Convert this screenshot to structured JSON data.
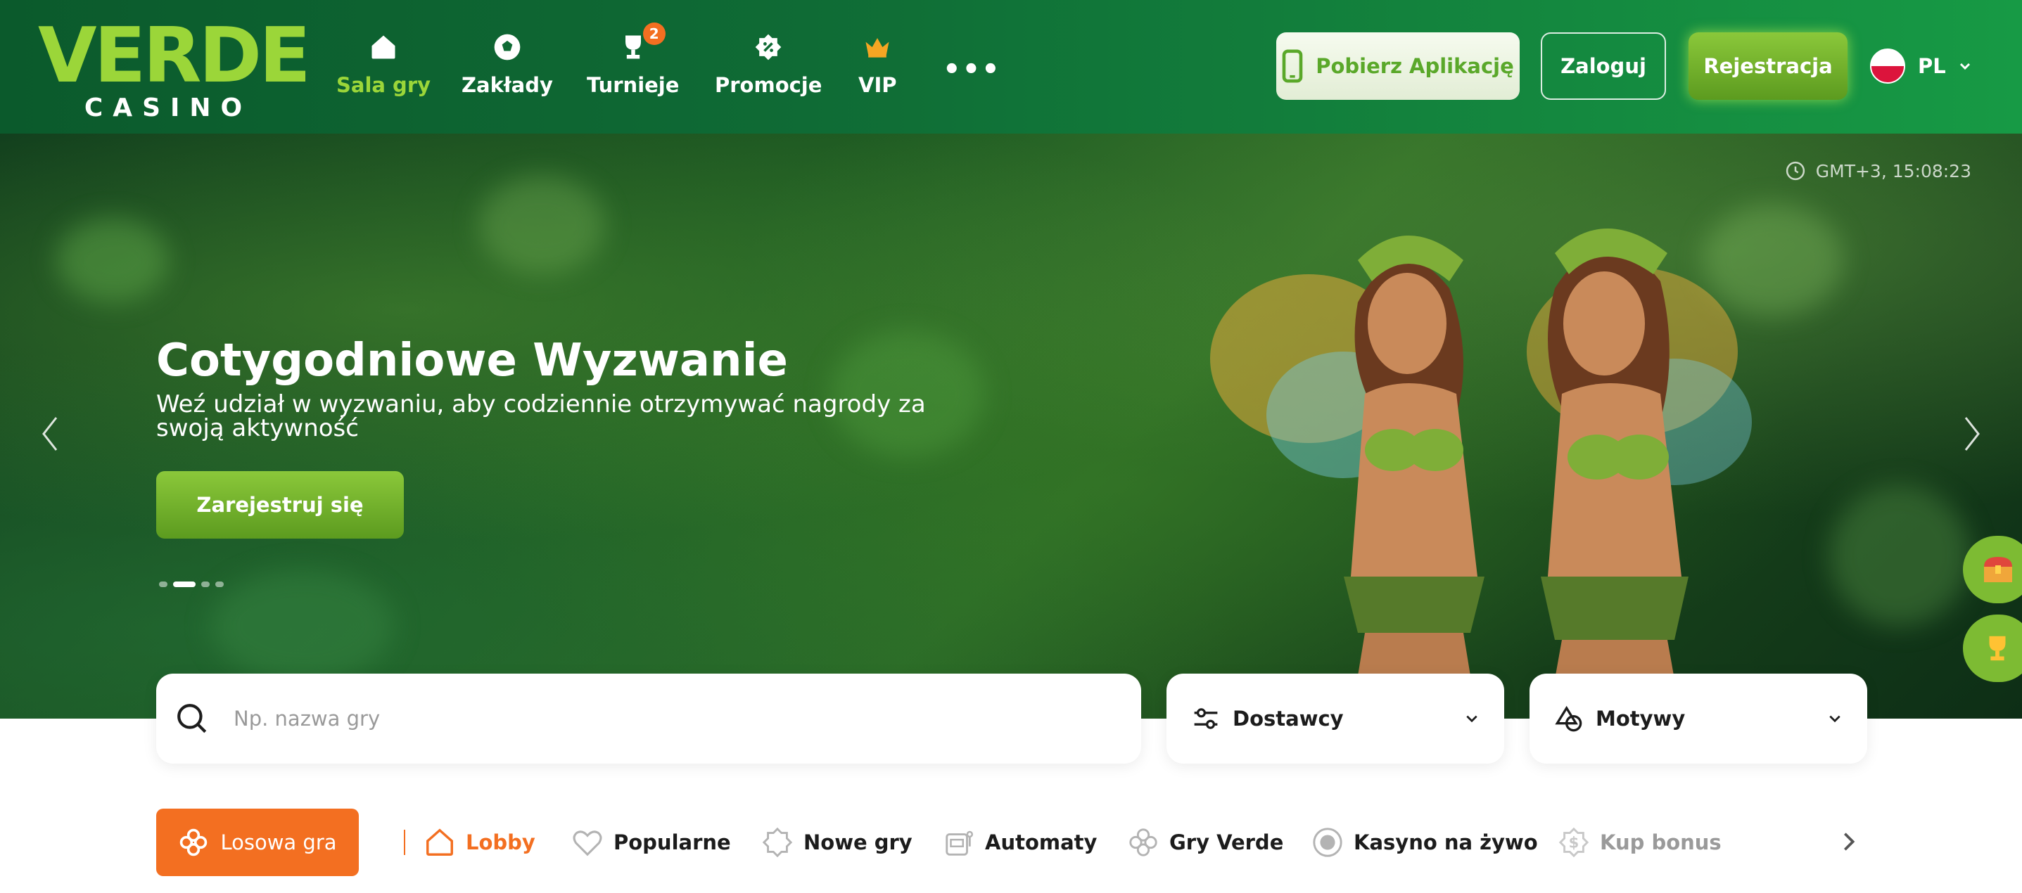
{
  "brand": {
    "name_top": "VERDE",
    "name_bottom": "CASINO"
  },
  "nav": [
    {
      "label": "Sala gry",
      "icon": "home-icon",
      "active": true
    },
    {
      "label": "Zakłady",
      "icon": "soccer-ball-icon"
    },
    {
      "label": "Turnieje",
      "icon": "trophy-icon",
      "badge": "2"
    },
    {
      "label": "Promocje",
      "icon": "percent-badge-icon"
    },
    {
      "label": "VIP",
      "icon": "crown-icon"
    }
  ],
  "header": {
    "more": "•••",
    "app_button": "Pobierz Aplikację",
    "login_button": "Zaloguj",
    "register_button": "Rejestracja",
    "language": "PL"
  },
  "hero": {
    "time": "GMT+3,  15:08:23",
    "title": "Cotygodniowe Wyzwanie",
    "subtitle": "Weź udział w wyzwaniu, aby codziennie otrzymywać nagrody za swoją aktywność",
    "cta": "Zarejestruj się",
    "slides": 4,
    "active_slide": 1
  },
  "search": {
    "placeholder": "Np. nazwa gry"
  },
  "filters": {
    "providers": "Dostawcy",
    "themes": "Motywy"
  },
  "categories": {
    "random": "Losowa gra",
    "items": [
      {
        "label": "Lobby",
        "icon": "house-outline-icon",
        "active": true
      },
      {
        "label": "Popularne",
        "icon": "heart-icon"
      },
      {
        "label": "Nowe gry",
        "icon": "new-badge-icon"
      },
      {
        "label": "Automaty",
        "icon": "slot-machine-icon"
      },
      {
        "label": "Gry Verde",
        "icon": "clover-icon"
      },
      {
        "label": "Kasyno na żywo",
        "icon": "live-casino-icon"
      },
      {
        "label": "Kup bonus",
        "icon": "dollar-badge-icon"
      }
    ]
  },
  "colors": {
    "accent": "#f36f21",
    "brand_green": "#9bd639",
    "header_dark": "#0b5a2c"
  }
}
